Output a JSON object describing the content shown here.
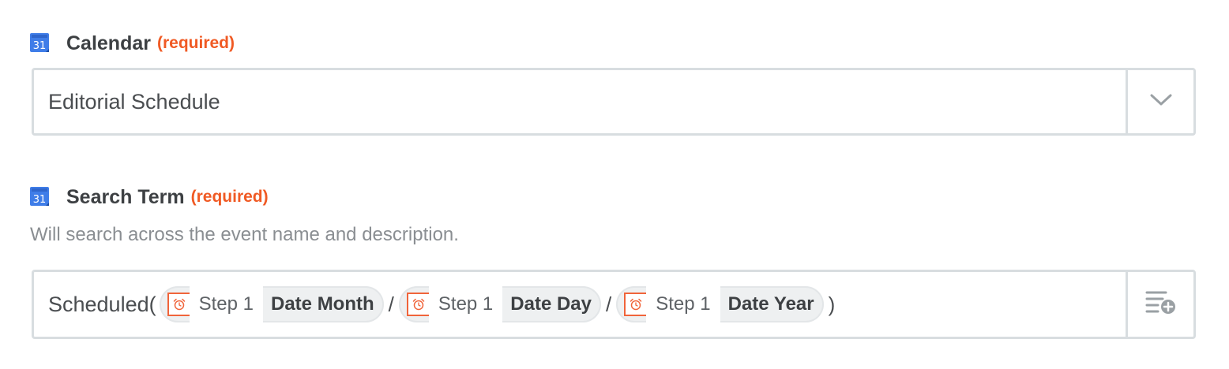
{
  "calendar_field": {
    "label": "Calendar",
    "required": "(required)",
    "value": "Editorial Schedule",
    "icon": "google-calendar-icon"
  },
  "search_field": {
    "label": "Search Term",
    "required": "(required)",
    "help": "Will search across the event name and description.",
    "icon": "google-calendar-icon",
    "prefix": "Scheduled(",
    "tokens": [
      {
        "step": "Step 1",
        "field": "Date Month"
      },
      {
        "step": "Step 1",
        "field": "Date Day"
      },
      {
        "step": "Step 1",
        "field": "Date Year"
      }
    ],
    "separator": "/",
    "suffix": ")"
  },
  "colors": {
    "required": "#f05a24",
    "calendar_icon": "#3f7de8",
    "token_icon": "#f0643a"
  }
}
